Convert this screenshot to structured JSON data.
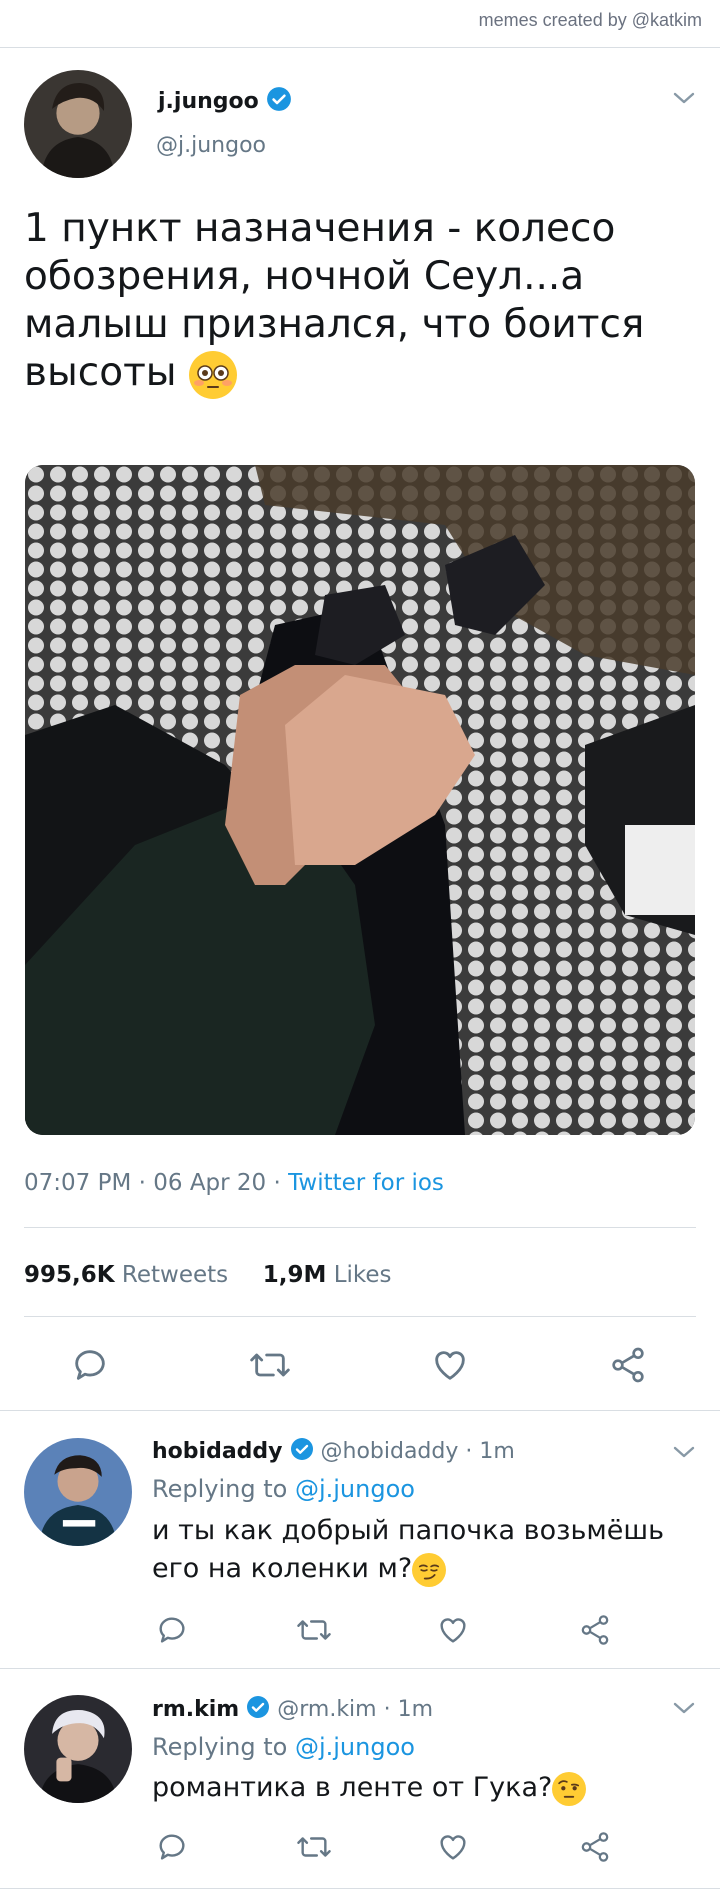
{
  "credit": "memes created by @katkim",
  "tweet": {
    "name": "j.jungoo",
    "handle": "@j.jungoo",
    "text": "1 пункт назначения - колесо обозрения, ночной Сеул...а малыш признался, что боится высоты",
    "emoji": "flushed-face",
    "time": "07:07 PM",
    "date": "06 Apr 20",
    "source": "Twitter for ios",
    "retweets_count": "995,6K",
    "retweets_label": "Retweets",
    "likes_count": "1,9M",
    "likes_label": "Likes"
  },
  "replies": [
    {
      "name": "hobidaddy",
      "handle": "@hobidaddy",
      "time": "1m",
      "replying_prefix": "Replying to",
      "replying_to": "@j.jungoo",
      "text": "и ты как добрый папочка возьмёшь его на коленки м?",
      "emoji": "smirking-face"
    },
    {
      "name": "rm.kim",
      "handle": "@rm.kim",
      "time": "1m",
      "replying_prefix": "Replying to",
      "replying_to": "@j.jungoo",
      "text": "романтика в ленте от Гука?",
      "emoji": "face-with-raised-eyebrow"
    }
  ],
  "colors": {
    "accent": "#1b95e0",
    "secondary_text": "#657786",
    "divider": "#d9dee3"
  }
}
